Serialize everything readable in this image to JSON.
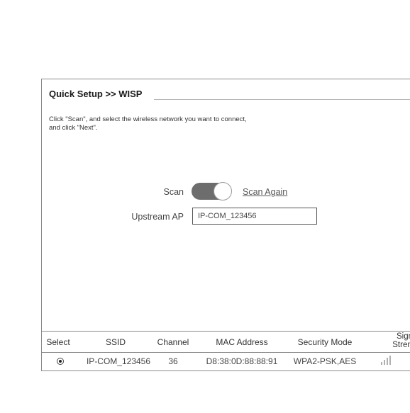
{
  "header": {
    "title": "Quick Setup >> WISP"
  },
  "instructions": {
    "line1": "Click \"Scan\", and select the wireless network you want to connect,",
    "line2": "and click \"Next\"."
  },
  "scan": {
    "label": "Scan",
    "toggle_on": true,
    "scan_again": "Scan Again"
  },
  "upstream": {
    "label": "Upstream AP",
    "value": "IP-COM_123456"
  },
  "table": {
    "headers": {
      "select": "Select",
      "ssid": "SSID",
      "channel": "Channel",
      "mac": "MAC Address",
      "security": "Security Mode",
      "signal_line1": "Signal",
      "signal_line2": "Strength"
    },
    "rows": [
      {
        "selected": true,
        "ssid": "IP-COM_123456",
        "channel": "36",
        "mac": "D8:38:0D:88:88:91",
        "security": "WPA2-PSK,AES",
        "signal_bars": 4
      }
    ]
  },
  "colors": {
    "toggle_on": "#6d6d6d",
    "border": "#8a8a8a"
  }
}
